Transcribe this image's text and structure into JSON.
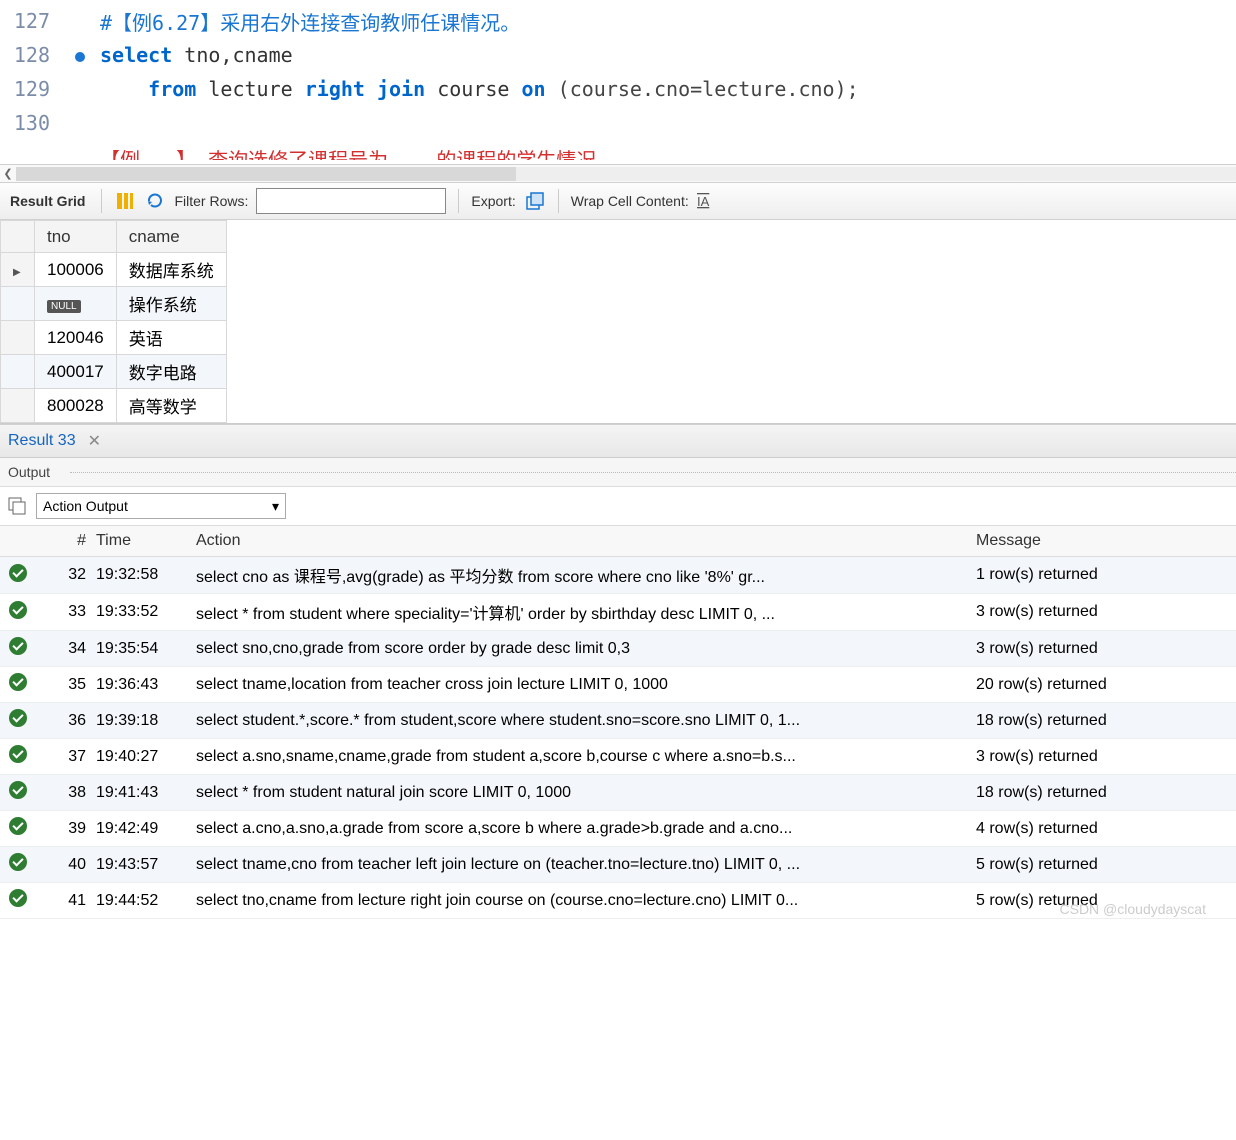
{
  "editor": {
    "lines": [
      {
        "num": "127",
        "bp": false,
        "html": "<span class='comment'>#【例6.27】采用右外连接查询教师任课情况。</span>"
      },
      {
        "num": "128",
        "bp": true,
        "html": "<span class='keyword'>select</span> <span class='ident'>tno,cname</span>"
      },
      {
        "num": "129",
        "bp": false,
        "html": "    <span class='keyword'>from</span> <span class='ident'>lecture</span> <span class='keyword'>right</span> <span class='keyword'>join</span> <span class='ident'>course</span> <span class='keyword'>on</span> <span class='paren'>(course.cno=lecture.cno);</span>"
      },
      {
        "num": "130",
        "bp": false,
        "html": ""
      }
    ],
    "partial": "【例...】 查询选修了课程号为... 的课程的学生情况"
  },
  "toolbar": {
    "result_grid": "Result Grid",
    "filter_label": "Filter Rows:",
    "filter_value": "",
    "export_label": "Export:",
    "wrap_label": "Wrap Cell Content:"
  },
  "grid": {
    "headers": [
      "tno",
      "cname"
    ],
    "rows": [
      {
        "tno": "100006",
        "cname": "数据库系统",
        "null": false,
        "active": true
      },
      {
        "tno": "NULL",
        "cname": "操作系统",
        "null": true,
        "active": false
      },
      {
        "tno": "120046",
        "cname": "英语",
        "null": false,
        "active": false
      },
      {
        "tno": "400017",
        "cname": "数字电路",
        "null": false,
        "active": false
      },
      {
        "tno": "800028",
        "cname": "高等数学",
        "null": false,
        "active": false
      }
    ]
  },
  "result_tab": {
    "label": "Result 33"
  },
  "output": {
    "title": "Output",
    "dropdown": "Action Output",
    "head": {
      "num": "#",
      "time": "Time",
      "action": "Action",
      "msg": "Message"
    },
    "rows": [
      {
        "n": "32",
        "t": "19:32:58",
        "a": "select cno as 课程号,avg(grade) as 平均分数 from score where cno like '8%'    gr...",
        "m": "1 row(s) returned"
      },
      {
        "n": "33",
        "t": "19:33:52",
        "a": "select * from student where speciality='计算机'    order by sbirthday desc LIMIT 0, ...",
        "m": "3 row(s) returned"
      },
      {
        "n": "34",
        "t": "19:35:54",
        "a": "select sno,cno,grade from score order by grade desc    limit 0,3",
        "m": "3 row(s) returned"
      },
      {
        "n": "35",
        "t": "19:36:43",
        "a": "select tname,location from teacher cross join lecture LIMIT 0, 1000",
        "m": "20 row(s) returned"
      },
      {
        "n": "36",
        "t": "19:39:18",
        "a": "select student.*,score.* from student,score where student.sno=score.sno LIMIT 0, 1...",
        "m": "18 row(s) returned"
      },
      {
        "n": "37",
        "t": "19:40:27",
        "a": "select a.sno,sname,cname,grade from student a,score b,course c where a.sno=b.s...",
        "m": "3 row(s) returned"
      },
      {
        "n": "38",
        "t": "19:41:43",
        "a": "select * from student natural join score LIMIT 0, 1000",
        "m": "18 row(s) returned"
      },
      {
        "n": "39",
        "t": "19:42:49",
        "a": "select a.cno,a.sno,a.grade from score a,score b where a.grade>b.grade and a.cno...",
        "m": "4 row(s) returned"
      },
      {
        "n": "40",
        "t": "19:43:57",
        "a": "select tname,cno from teacher left join lecture on (teacher.tno=lecture.tno) LIMIT 0, ...",
        "m": "5 row(s) returned"
      },
      {
        "n": "41",
        "t": "19:44:52",
        "a": "select tno,cname from lecture right join course on (course.cno=lecture.cno) LIMIT 0...",
        "m": "5 row(s) returned"
      }
    ]
  },
  "watermark": "CSDN @cloudydayscat"
}
